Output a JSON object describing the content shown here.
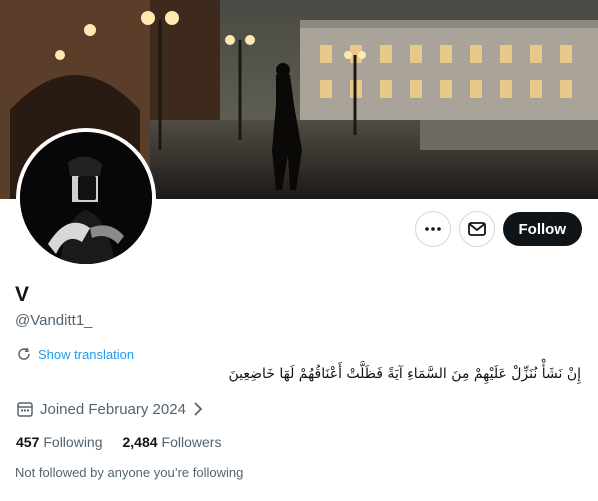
{
  "profile": {
    "name": "V",
    "handle": "@Vanditt1_",
    "bio": "إِنْ نَشَأْ نُنَزِّلْ عَلَيْهِمْ مِنَ السَّمَاءِ آيَةً فَظَلَّتْ أَعْنَاقُهُمْ لَهَا خَاضِعِينَ",
    "translate_label": "Show translation",
    "joined": "Joined February 2024",
    "following_count": "457",
    "following_label": "Following",
    "followers_count": "2,484",
    "followers_label": "Followers",
    "followed_by": "Not followed by anyone you’re following"
  },
  "actions": {
    "follow_label": "Follow",
    "more_icon": "more-icon",
    "message_icon": "mail-icon"
  },
  "colors": {
    "link": "#1d9bf0",
    "muted": "#536471",
    "button_dark": "#0f1419"
  }
}
